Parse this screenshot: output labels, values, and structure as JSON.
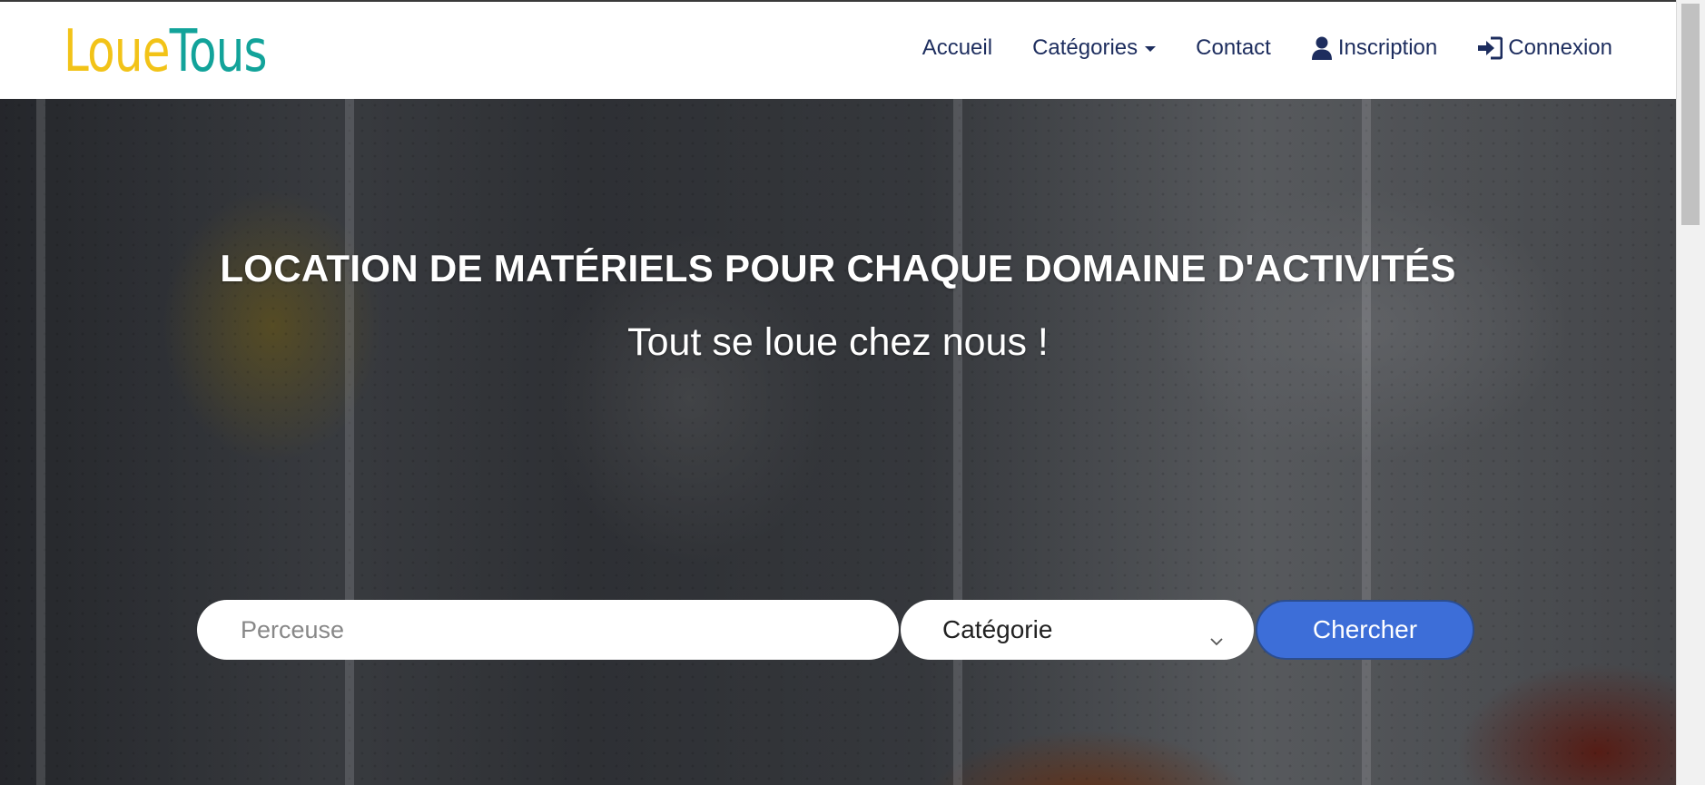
{
  "brand": {
    "part1": "Loue",
    "part2": "Tous"
  },
  "nav": {
    "home": "Accueil",
    "categories": "Catégories",
    "contact": "Contact",
    "signup": "Inscription",
    "login": "Connexion"
  },
  "hero": {
    "title": "LOCATION DE MATÉRIELS POUR CHAQUE DOMAINE D'ACTIVITÉS",
    "subtitle": "Tout se loue chez nous !"
  },
  "search": {
    "placeholder": "Perceuse",
    "value": "",
    "category_selected": "Catégorie",
    "button_label": "Chercher"
  },
  "colors": {
    "brand_yellow": "#f2c318",
    "brand_teal": "#12a39a",
    "nav_text": "#1d2d5e",
    "button_blue": "#3d6ed8"
  },
  "icons": {
    "signup": "user-icon",
    "login": "sign-in-icon",
    "categories_caret": "caret-down-icon",
    "select_chevron": "chevron-down-icon"
  }
}
